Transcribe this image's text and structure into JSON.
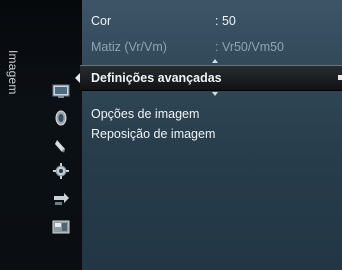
{
  "sidebar": {
    "title": "Imagem",
    "icons": [
      "picture-icon",
      "sound-icon",
      "channel-icon",
      "setup-icon",
      "input-icon",
      "application-icon"
    ]
  },
  "menu": {
    "rows": [
      {
        "label": "Cor",
        "value": ": 50"
      },
      {
        "label": "Matiz (Vr/Vm)",
        "value": ": Vr50/Vm50"
      },
      {
        "label": "Definições avançadas",
        "value": ""
      },
      {
        "label": "Opções de imagem",
        "value": ""
      },
      {
        "label": "Reposição de imagem",
        "value": ""
      }
    ]
  },
  "colors": {
    "panel_top": "#3d5567",
    "panel_bottom": "#223645",
    "sidebar": "#0b1015",
    "selection": "#1c1f22",
    "text": "#f0f3f6",
    "text_dim": "#8fa4b2"
  }
}
